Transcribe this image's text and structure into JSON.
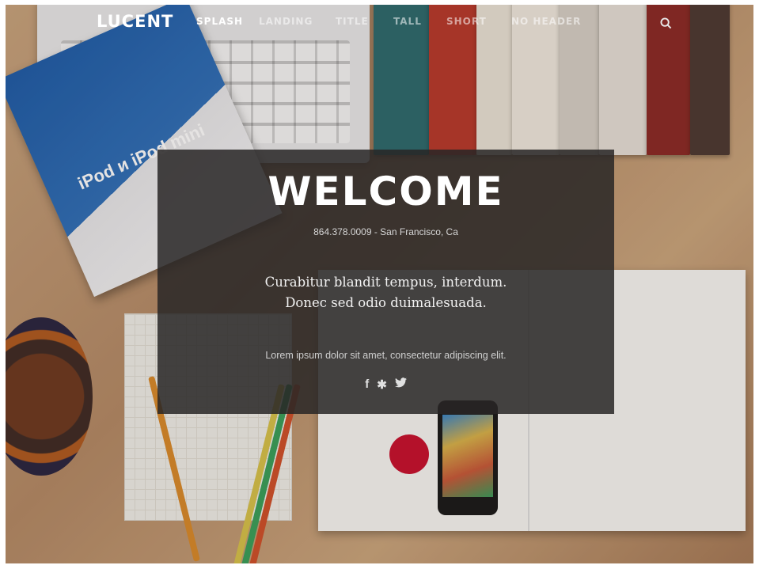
{
  "nav": {
    "brand": "LUCENT",
    "items": [
      {
        "label": "SPLASH",
        "active": true
      },
      {
        "label": "LANDING",
        "active": false
      },
      {
        "label": "TITLE",
        "active": false
      },
      {
        "label": "TALL",
        "active": false
      },
      {
        "label": "SHORT",
        "active": false
      },
      {
        "label": "NO HEADER",
        "active": false
      }
    ],
    "search_icon": "search-icon"
  },
  "hero": {
    "title": "WELCOME",
    "contact": "864.378.0009 - San Francisco, Ca",
    "lead_line1": "Curabitur blandit tempus, interdum.",
    "lead_line2": "Donec sed odio duimalesuada.",
    "body": "Lorem ipsum dolor sit amet, consectetur adipiscing elit.",
    "social": [
      {
        "icon": "facebook-icon",
        "glyph": "f"
      },
      {
        "icon": "yelp-icon",
        "glyph": "✱"
      },
      {
        "icon": "twitter-icon",
        "glyph": "🐦"
      }
    ]
  },
  "background": {
    "ipod_text": "iPod и iPod mini"
  },
  "colors": {
    "panel": "#282626",
    "nav_text": "#ffffff"
  }
}
